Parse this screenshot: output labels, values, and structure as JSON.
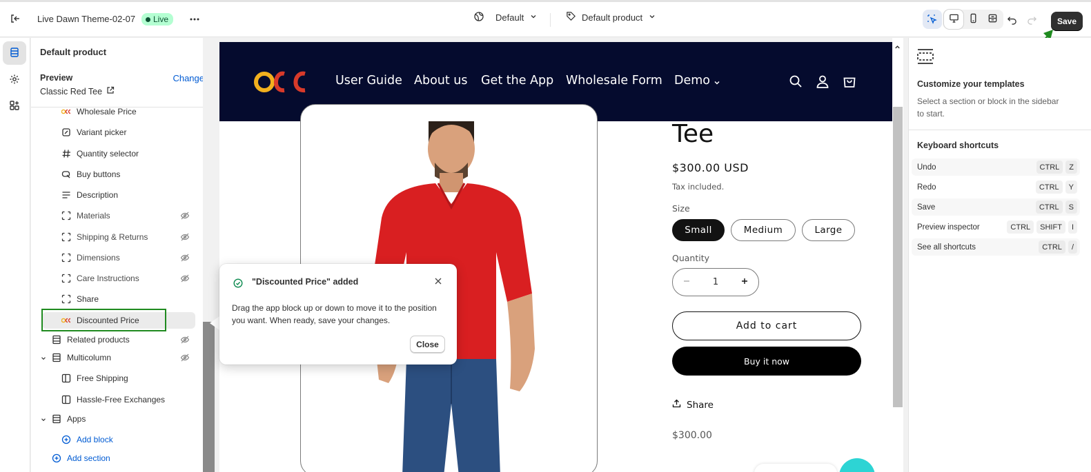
{
  "topbar": {
    "theme_name": "Live Dawn Theme-02-07",
    "live_badge": "Live",
    "template_selector": "Default",
    "product_selector": "Default product",
    "save_label": "Save"
  },
  "sidebar": {
    "title": "Default product",
    "preview_label": "Preview",
    "change_link": "Change",
    "preview_product": "Classic Red Tee",
    "items": [
      {
        "label": "Wholesale Price",
        "icon": "osc-app-icon",
        "hidden": false
      },
      {
        "label": "Variant picker",
        "icon": "variant-picker-icon",
        "hidden": false
      },
      {
        "label": "Quantity selector",
        "icon": "hash-icon",
        "hidden": false
      },
      {
        "label": "Buy buttons",
        "icon": "buy-buttons-icon",
        "hidden": false
      },
      {
        "label": "Description",
        "icon": "text-lines-icon",
        "hidden": false
      },
      {
        "label": "Materials",
        "icon": "dashed-block-icon",
        "hidden": true
      },
      {
        "label": "Shipping & Returns",
        "icon": "dashed-block-icon",
        "hidden": true
      },
      {
        "label": "Dimensions",
        "icon": "dashed-block-icon",
        "hidden": true
      },
      {
        "label": "Care Instructions",
        "icon": "dashed-block-icon",
        "hidden": true
      },
      {
        "label": "Share",
        "icon": "dashed-block-icon",
        "hidden": false
      },
      {
        "label": "Discounted Price",
        "icon": "osc-app-icon",
        "hidden": false
      }
    ],
    "sections": [
      {
        "label": "Related products",
        "hidden": true
      },
      {
        "label": "Multicolumn",
        "hidden": true
      },
      {
        "label": "Free Shipping"
      },
      {
        "label": "Hassle-Free Exchanges"
      },
      {
        "label": "Apps"
      }
    ],
    "add_block": "Add block",
    "add_section": "Add section"
  },
  "store": {
    "nav": [
      "User Guide",
      "About us",
      "Get the App",
      "Wholesale Form",
      "Demo"
    ],
    "product_title": "Tee",
    "price": "$300.00 USD",
    "tax_note": "Tax included.",
    "size_label": "Size",
    "sizes": [
      "Small",
      "Medium",
      "Large"
    ],
    "selected_size": "Small",
    "quantity_label": "Quantity",
    "quantity": "1",
    "add_to_cart": "Add to cart",
    "buy_now": "Buy it now",
    "share": "Share",
    "discounted_price": "$300.00"
  },
  "toast": {
    "title": "\"Discounted Price\" added",
    "body": "Drag the app block up or down to move it to the position you want. When ready, save your changes.",
    "close_label": "Close"
  },
  "right_panel": {
    "title": "Customize your templates",
    "description": "Select a section or block in the sidebar to start.",
    "shortcuts_title": "Keyboard shortcuts",
    "shortcuts": [
      {
        "label": "Undo",
        "keys": [
          "CTRL",
          "Z"
        ]
      },
      {
        "label": "Redo",
        "keys": [
          "CTRL",
          "Y"
        ]
      },
      {
        "label": "Save",
        "keys": [
          "CTRL",
          "S"
        ]
      },
      {
        "label": "Preview inspector",
        "keys": [
          "CTRL",
          "SHIFT",
          "I"
        ]
      },
      {
        "label": "See all shortcuts",
        "keys": [
          "CTRL",
          "/"
        ]
      }
    ]
  },
  "colors": {
    "store_header": "#050b2e",
    "accent_link": "#005bd3",
    "highlight_box": "#1f8a1f",
    "live_badge_bg": "#b4fed2"
  }
}
